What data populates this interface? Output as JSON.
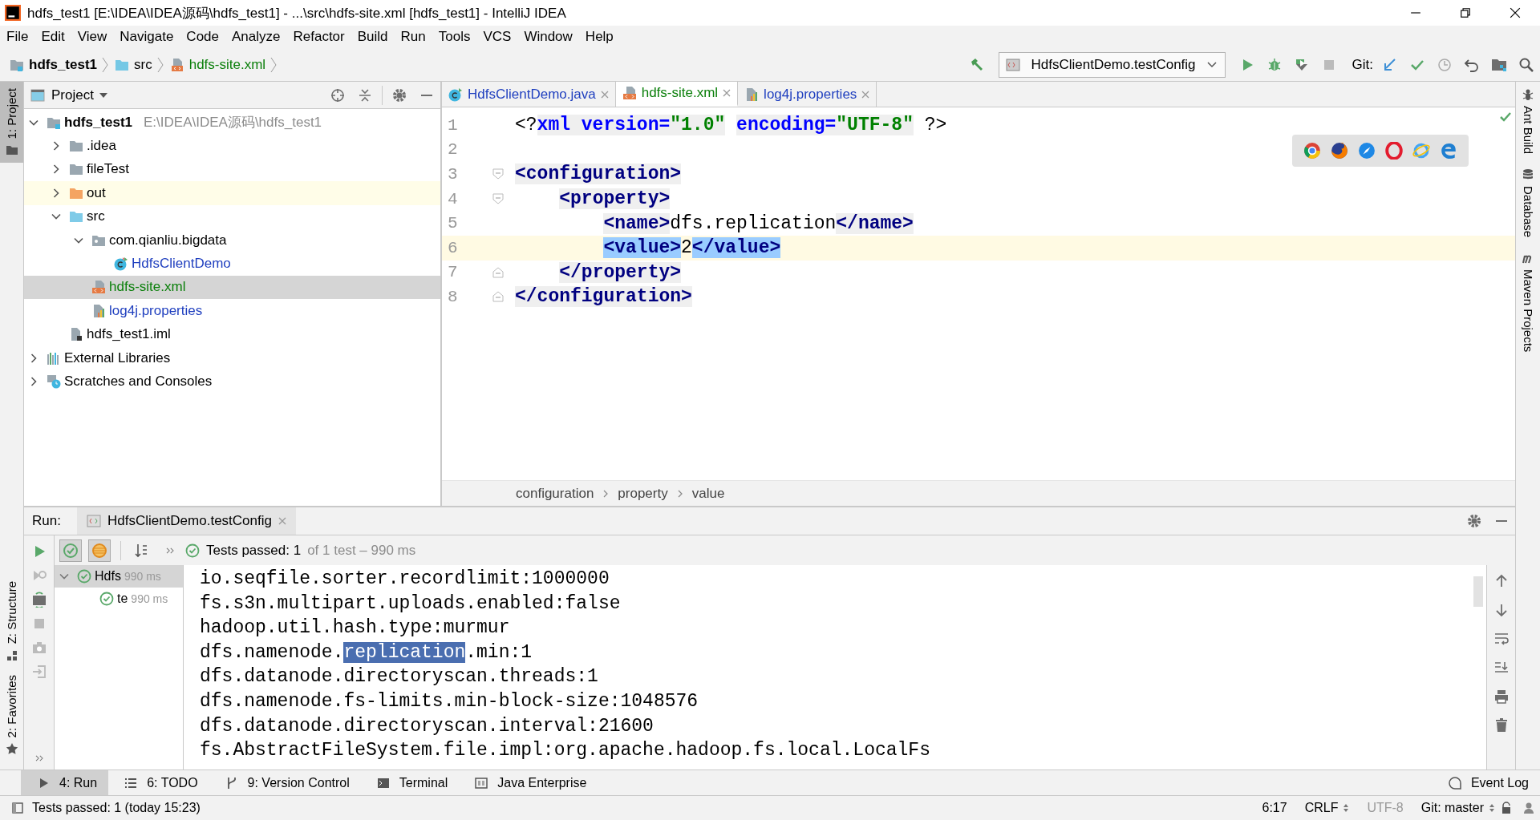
{
  "window": {
    "title": "hdfs_test1 [E:\\IDEA\\IDEA源码\\hdfs_test1] - ...\\src\\hdfs-site.xml [hdfs_test1] - IntelliJ IDEA"
  },
  "menu": [
    "File",
    "Edit",
    "View",
    "Navigate",
    "Code",
    "Analyze",
    "Refactor",
    "Build",
    "Run",
    "Tools",
    "VCS",
    "Window",
    "Help"
  ],
  "breadcrumbs": [
    {
      "label": "hdfs_test1",
      "kind": "module"
    },
    {
      "label": "src",
      "kind": "source"
    },
    {
      "label": "hdfs-site.xml",
      "kind": "xml"
    }
  ],
  "toolbar": {
    "run_config": "HdfsClientDemo.testConfig",
    "git_label": "Git:"
  },
  "left_strip": [
    {
      "label": "1: Project",
      "kind": "project",
      "selected": true
    },
    {
      "label": "Z: Structure",
      "kind": "structure",
      "selected": false
    },
    {
      "label": "2: Favorites",
      "kind": "favorites",
      "selected": false
    }
  ],
  "right_strip": [
    {
      "label": "Ant Build",
      "kind": "ant"
    },
    {
      "label": "Database",
      "kind": "database"
    },
    {
      "label": "Maven Projects",
      "kind": "maven"
    }
  ],
  "project_panel": {
    "title": "Project",
    "tree": [
      {
        "label": "hdfs_test1",
        "path": "E:\\IDEA\\IDEA源码\\hdfs_test1",
        "kind": "module",
        "expanded": true,
        "selected": false,
        "children": [
          {
            "label": ".idea",
            "kind": "folder",
            "expanded": false,
            "selected": false
          },
          {
            "label": "fileTest",
            "kind": "folder",
            "expanded": false,
            "selected": false
          },
          {
            "label": "out",
            "kind": "excluded",
            "expanded": false,
            "selected": false
          },
          {
            "label": "src",
            "kind": "source",
            "expanded": true,
            "selected": false,
            "children": [
              {
                "label": "com.qianliu.bigdata",
                "kind": "package",
                "expanded": true,
                "selected": false,
                "children": [
                  {
                    "label": "HdfsClientDemo",
                    "kind": "class",
                    "color": "#1f3fbf",
                    "selected": false
                  }
                ]
              },
              {
                "label": "hdfs-site.xml",
                "kind": "xml",
                "color": "#0a7f0a",
                "selected": true
              },
              {
                "label": "log4j.properties",
                "kind": "properties",
                "color": "#1f3fbf",
                "selected": false
              }
            ]
          },
          {
            "label": "hdfs_test1.iml",
            "kind": "iml",
            "selected": false
          }
        ]
      },
      {
        "label": "External Libraries",
        "kind": "libraries",
        "expanded": false,
        "selected": false
      },
      {
        "label": "Scratches and Consoles",
        "kind": "scratches",
        "expanded": false,
        "selected": false
      }
    ]
  },
  "editor": {
    "tabs": [
      {
        "label": "HdfsClientDemo.java",
        "kind": "class",
        "color": "#1f3fbf",
        "selected": false
      },
      {
        "label": "hdfs-site.xml",
        "kind": "xml",
        "color": "#0a7f0a",
        "selected": true
      },
      {
        "label": "log4j.properties",
        "kind": "properties",
        "color": "#1f3fbf",
        "selected": false
      }
    ],
    "lines": [
      {
        "number": "1",
        "current": false,
        "segments": [
          {
            "t": "<?",
            "kind": "text",
            "shaded": false,
            "matched": false
          },
          {
            "t": "xml version=",
            "kind": "attr",
            "shaded": true,
            "matched": false
          },
          {
            "t": "\"1.0\"",
            "kind": "str",
            "shaded": true,
            "matched": false
          },
          {
            "t": " encoding=",
            "kind": "attr",
            "shaded": true,
            "matched": false
          },
          {
            "t": "\"UTF-8\"",
            "kind": "str",
            "shaded": true,
            "matched": false
          },
          {
            "t": " ?>",
            "kind": "text",
            "shaded": false,
            "matched": false
          }
        ]
      },
      {
        "number": "2",
        "current": false
      },
      {
        "number": "3",
        "current": false,
        "kind": "fold-start",
        "segments": [
          {
            "t": "<configuration>",
            "kind": "tag",
            "shaded": true,
            "matched": false
          }
        ]
      },
      {
        "number": "4",
        "current": false,
        "kind": "fold-start",
        "segments": [
          {
            "t": "    <property>",
            "kind": "tag",
            "shaded": true,
            "matched": false
          }
        ]
      },
      {
        "number": "5",
        "current": false,
        "segments": [
          {
            "t": "        <name>",
            "kind": "tag",
            "shaded": true,
            "matched": false
          },
          {
            "t": "dfs.replication",
            "kind": "text",
            "shaded": false,
            "matched": false
          },
          {
            "t": "</name>",
            "kind": "tag",
            "shaded": true,
            "matched": false
          }
        ]
      },
      {
        "number": "6",
        "current": true,
        "segments": [
          {
            "t": "        <value>",
            "kind": "tag",
            "shaded": true,
            "matched": true
          },
          {
            "t": "2",
            "kind": "text",
            "shaded": false,
            "matched": false
          },
          {
            "t": "</value>",
            "kind": "tag",
            "shaded": true,
            "matched": true
          }
        ]
      },
      {
        "number": "7",
        "current": false,
        "kind": "fold-end",
        "segments": [
          {
            "t": "    </property>",
            "kind": "tag",
            "shaded": true,
            "matched": false
          }
        ]
      },
      {
        "number": "8",
        "current": false,
        "kind": "fold-end",
        "segments": [
          {
            "t": "</configuration>",
            "kind": "tag",
            "shaded": true,
            "matched": false
          }
        ]
      }
    ],
    "breadcrumb": [
      "configuration",
      "property",
      "value"
    ]
  },
  "run_panel": {
    "label": "Run:",
    "tab": "HdfsClientDemo.testConfig",
    "summary": "Tests passed: 1",
    "detail": "of 1 test – 990 ms",
    "tests": [
      {
        "label": "Hdfs",
        "time": "990 ms",
        "expanded": true,
        "selected": true,
        "children": [
          {
            "label": "te",
            "time": "990 ms",
            "selected": false
          }
        ]
      }
    ],
    "console": [
      {
        "parts": [
          {
            "text": "io.seqfile.sorter.recordlimit:1000000",
            "selected": false
          }
        ]
      },
      {
        "parts": [
          {
            "text": "fs.s3n.multipart.uploads.enabled:false",
            "selected": false
          }
        ]
      },
      {
        "parts": [
          {
            "text": "hadoop.util.hash.type:murmur",
            "selected": false
          }
        ]
      },
      {
        "parts": [
          {
            "text": "dfs.namenode.",
            "selected": false
          },
          {
            "text": "replication",
            "selected": true
          },
          {
            "text": ".min:1",
            "selected": false
          }
        ]
      },
      {
        "parts": [
          {
            "text": "dfs.datanode.directoryscan.threads:1",
            "selected": false
          }
        ]
      },
      {
        "parts": [
          {
            "text": "dfs.namenode.fs-limits.min-block-size:1048576",
            "selected": false
          }
        ]
      },
      {
        "parts": [
          {
            "text": "dfs.datanode.directoryscan.interval:21600",
            "selected": false
          }
        ]
      },
      {
        "parts": [
          {
            "text": "fs.AbstractFileSystem.file.impl:org.apache.hadoop.fs.local.LocalFs",
            "selected": false
          }
        ]
      }
    ]
  },
  "bottom_tabs": [
    {
      "label": "4: Run",
      "kind": "run",
      "selected": true
    },
    {
      "label": "6: TODO",
      "kind": "todo",
      "selected": false
    },
    {
      "label": "9: Version Control",
      "kind": "vcs",
      "selected": false
    },
    {
      "label": "Terminal",
      "kind": "terminal",
      "selected": false
    },
    {
      "label": "Java Enterprise",
      "kind": "javaee",
      "selected": false
    }
  ],
  "event_log": "Event Log",
  "status_bar": {
    "message": "Tests passed: 1 (today 15:23)",
    "position": "6:17",
    "line_separator": "CRLF",
    "encoding": "UTF-8",
    "branch": "Git: master"
  }
}
